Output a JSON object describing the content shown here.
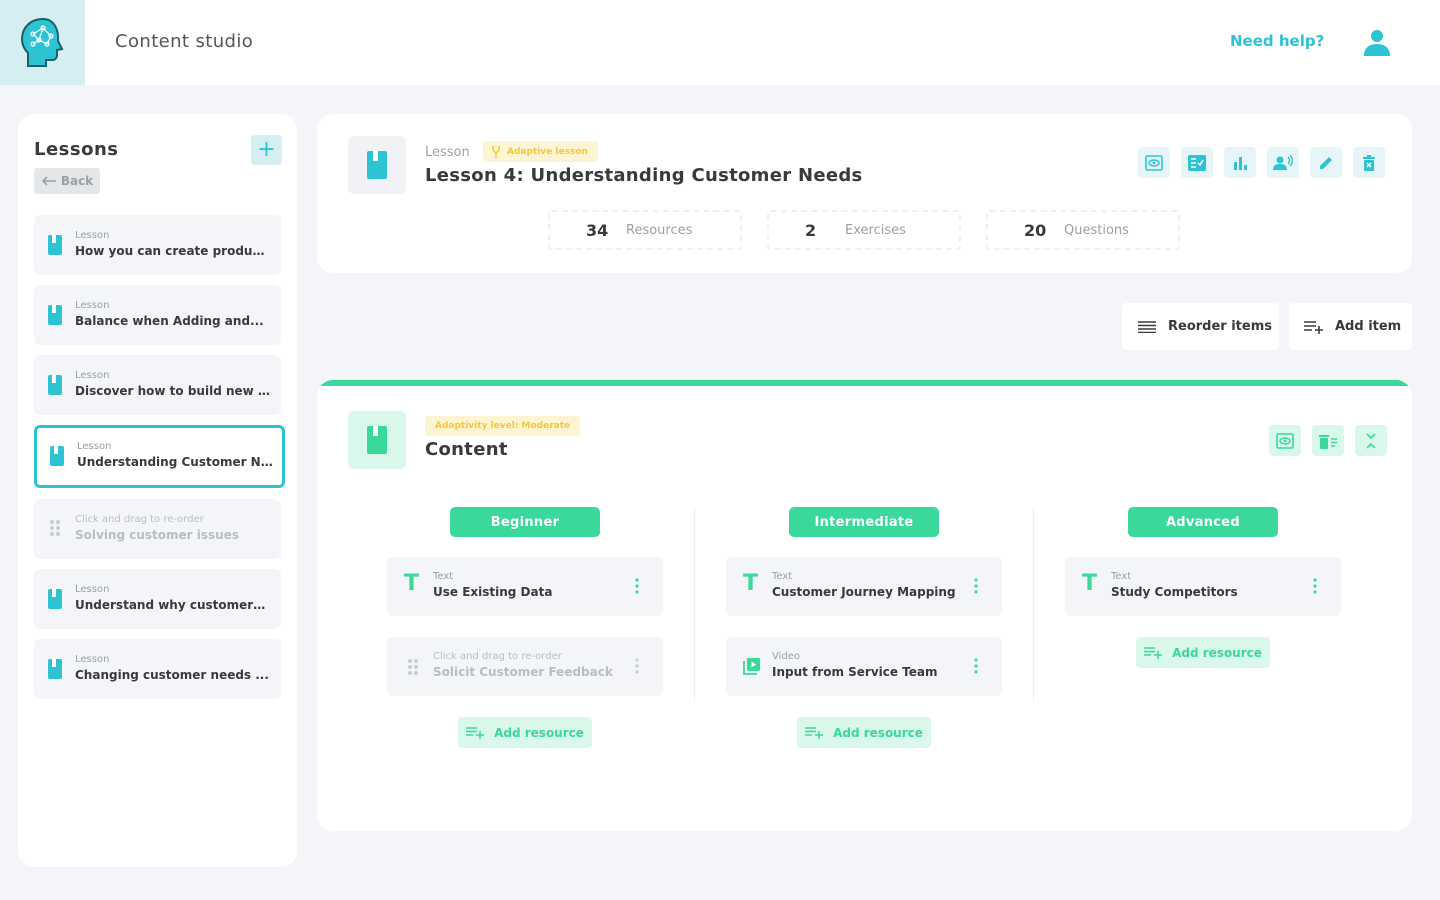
{
  "header": {
    "app_title": "Content studio",
    "help_label": "Need help?",
    "accent_color": "#2ec3d3"
  },
  "sidebar": {
    "title": "Lessons",
    "add_label": "+",
    "back_label": "Back",
    "items": [
      {
        "label": "Lesson",
        "name": "How you can create produc..."
      },
      {
        "label": "Lesson",
        "name": "Balance when Adding and..."
      },
      {
        "label": "Lesson",
        "name": "Discover how to build new c..."
      },
      {
        "label": "Lesson",
        "name": "Understanding Customer N..."
      },
      {
        "label": "Click and drag to re-order",
        "name": "Solving customer issues"
      },
      {
        "label": "Lesson",
        "name": "Understand why customers..."
      },
      {
        "label": "Lesson",
        "name": "Changing customer needs ..."
      }
    ]
  },
  "lesson": {
    "label": "Lesson",
    "badge": "Adaptive lesson",
    "title": "Lesson 4: Understanding Customer Needs",
    "stats": [
      {
        "value": "34",
        "label": "Resources"
      },
      {
        "value": "2",
        "label": "Exercises"
      },
      {
        "value": "20",
        "label": "Questions"
      }
    ]
  },
  "toolbar": {
    "reorder_label": "Reorder items",
    "add_item_label": "Add item"
  },
  "content": {
    "badge": "Adaptivity level: Moderate",
    "title": "Content",
    "green_color": "#3ad89b",
    "columns": [
      {
        "level": "Beginner",
        "resources": [
          {
            "type": "Text",
            "name": "Use Existing Data"
          },
          {
            "type": "Click and drag to re-order",
            "name": "Solicit Customer Feedback"
          }
        ],
        "add_label": "Add resource"
      },
      {
        "level": "Intermediate",
        "resources": [
          {
            "type": "Text",
            "name": "Customer Journey Mapping"
          },
          {
            "type": "Video",
            "name": "Input from Service Team"
          }
        ],
        "add_label": "Add resource"
      },
      {
        "level": "Advanced",
        "resources": [
          {
            "type": "Text",
            "name": "Study Competitors"
          }
        ],
        "add_label": "Add resource"
      }
    ]
  },
  "glyphs": {
    "text_glyph": "T"
  }
}
